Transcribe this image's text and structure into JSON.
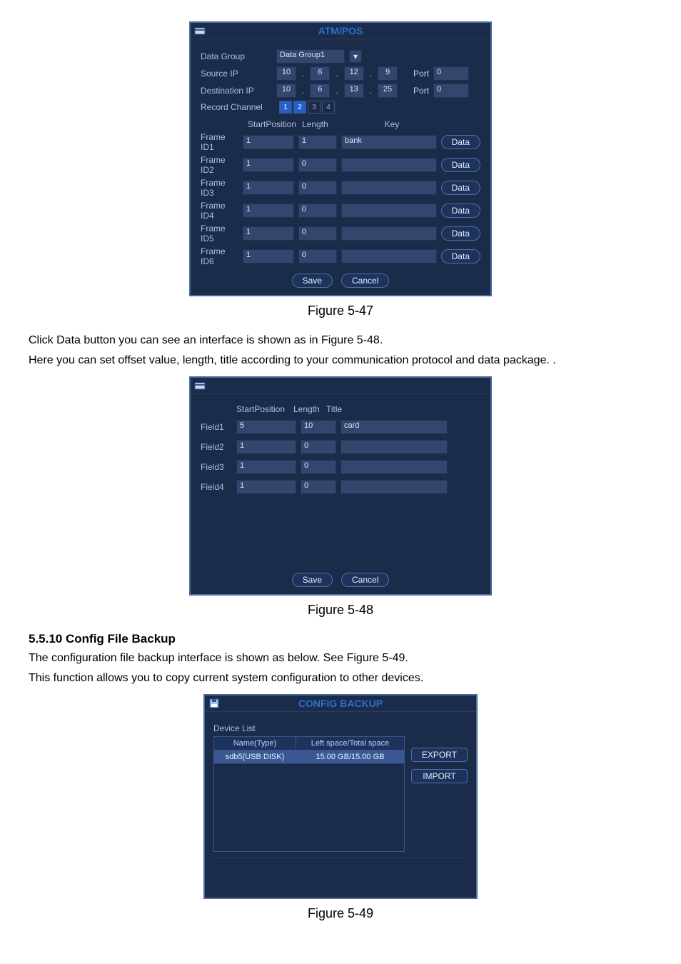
{
  "atmpos": {
    "title": "ATM/POS",
    "labels": {
      "data_group": "Data Group",
      "source_ip": "Source IP",
      "dest_ip": "Destination IP",
      "record_channel": "Record Channel",
      "port": "Port"
    },
    "data_group_value": "Data Group1",
    "source_ip_parts": [
      "10",
      "6",
      "12",
      "9"
    ],
    "source_port": "0",
    "dest_ip_parts": [
      "10",
      "6",
      "13",
      "25"
    ],
    "dest_port": "0",
    "record_channel": [
      "1",
      "2",
      "3",
      "4"
    ],
    "active_channels": [
      true,
      true,
      false,
      false
    ],
    "columns": {
      "start": "StartPosition",
      "length": "Length",
      "key": "Key"
    },
    "data_btn": "Data",
    "rows": [
      {
        "label": "Frame ID1",
        "start": "1",
        "len": "1",
        "key": "bank"
      },
      {
        "label": "Frame ID2",
        "start": "1",
        "len": "0",
        "key": ""
      },
      {
        "label": "Frame ID3",
        "start": "1",
        "len": "0",
        "key": ""
      },
      {
        "label": "Frame ID4",
        "start": "1",
        "len": "0",
        "key": ""
      },
      {
        "label": "Frame ID5",
        "start": "1",
        "len": "0",
        "key": ""
      },
      {
        "label": "Frame ID6",
        "start": "1",
        "len": "0",
        "key": ""
      }
    ],
    "buttons": {
      "save": "Save",
      "cancel": "Cancel"
    }
  },
  "fieldpanel": {
    "columns": {
      "start": "StartPosition",
      "length": "Length",
      "title": "Title"
    },
    "rows": [
      {
        "label": "Field1",
        "start": "5",
        "len": "10",
        "title": "card"
      },
      {
        "label": "Field2",
        "start": "1",
        "len": "0",
        "title": ""
      },
      {
        "label": "Field3",
        "start": "1",
        "len": "0",
        "title": ""
      },
      {
        "label": "Field4",
        "start": "1",
        "len": "0",
        "title": ""
      }
    ],
    "buttons": {
      "save": "Save",
      "cancel": "Cancel"
    }
  },
  "cfg": {
    "title": "CONFIG BACKUP",
    "device_list": "Device List",
    "columns": {
      "name": "Name(Type)",
      "space": "Left space/Total space"
    },
    "rows": [
      {
        "name": "sdb5(USB DISK)",
        "space": "15.00 GB/15.00 GB"
      }
    ],
    "buttons": {
      "export": "EXPORT",
      "import": "IMPORT"
    }
  },
  "captions": {
    "fig47": "Figure 5-47",
    "fig48": "Figure 5-48",
    "fig49": "Figure 5-49"
  },
  "text": {
    "p1": "Click Data button you can see an interface is shown as in Figure 5-48.",
    "p2": "Here you can set offset value, length, title according to your communication protocol and data package. .",
    "sec": "5.5.10 Config File Backup",
    "p3": "The configuration file backup interface is shown as below. See Figure 5-49.",
    "p4": "This function allows you to copy current system configuration to other devices."
  }
}
